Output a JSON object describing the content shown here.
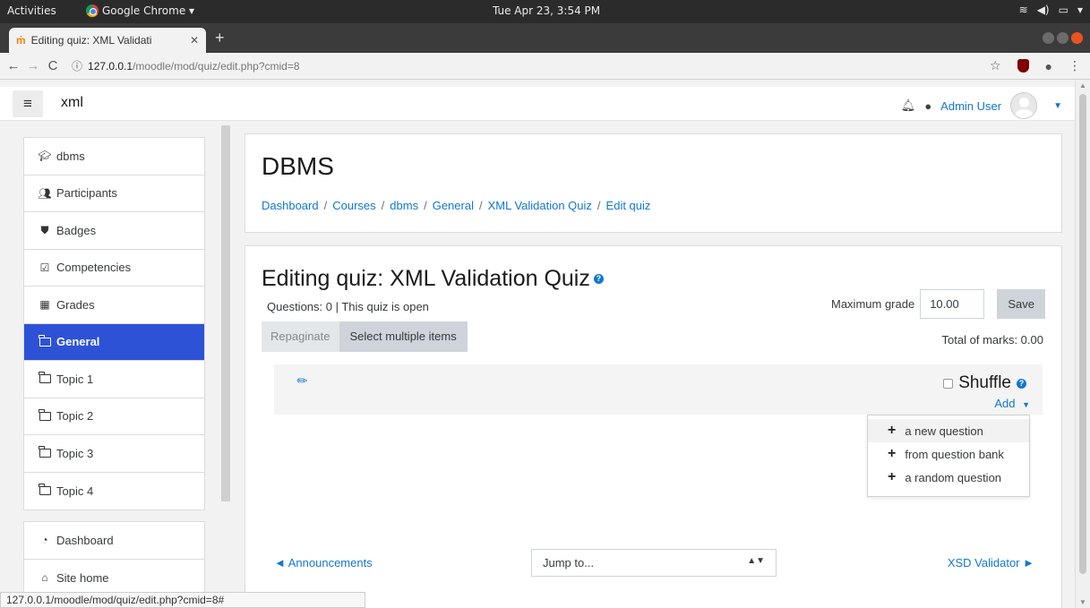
{
  "os_topbar": {
    "activities": "Activities",
    "app_menu": "Google Chrome ▾",
    "clock": "Tue Apr 23,  3:54 PM",
    "sys_icons": [
      "wifi-icon",
      "volume-icon",
      "battery-icon",
      "caret-down-icon"
    ]
  },
  "browser": {
    "tab_title": "Editing quiz: XML Validati",
    "tab_favicon": "moodle-icon",
    "url_host": "127.0.0.1",
    "url_path": "/moodle/mod/quiz/edit.php?cmid=8",
    "status_url": "127.0.0.1/moodle/mod/quiz/edit.php?cmid=8#"
  },
  "navbar": {
    "site_name": "xml",
    "user_name": "Admin User"
  },
  "drawer": {
    "course_items": [
      {
        "label": "dbms",
        "icon": "graduation-cap-icon"
      },
      {
        "label": "Participants",
        "icon": "users-icon"
      },
      {
        "label": "Badges",
        "icon": "shield-icon"
      },
      {
        "label": "Competencies",
        "icon": "check-square-icon"
      },
      {
        "label": "Grades",
        "icon": "table-icon"
      },
      {
        "label": "General",
        "icon": "folder-icon",
        "active": true
      },
      {
        "label": "Topic 1",
        "icon": "folder-icon"
      },
      {
        "label": "Topic 2",
        "icon": "folder-icon"
      },
      {
        "label": "Topic 3",
        "icon": "folder-icon"
      },
      {
        "label": "Topic 4",
        "icon": "folder-icon"
      }
    ],
    "site_items": [
      {
        "label": "Dashboard",
        "icon": "tachometer-icon"
      },
      {
        "label": "Site home",
        "icon": "home-icon"
      }
    ]
  },
  "header": {
    "course_title": "DBMS",
    "breadcrumb": [
      "Dashboard",
      "Courses",
      "dbms",
      "General",
      "XML Validation Quiz",
      "Edit quiz"
    ],
    "separator": "/"
  },
  "quiz": {
    "title": "Editing quiz: XML Validation Quiz",
    "status": "Questions: 0 | This quiz is open",
    "max_grade_label": "Maximum grade",
    "max_grade_value": "10.00",
    "save_label": "Save",
    "repaginate_label": "Repaginate",
    "select_multiple_label": "Select multiple items",
    "total_marks": "Total of marks: 0.00",
    "shuffle_label": "Shuffle",
    "add_label": "Add",
    "add_menu": [
      "a new question",
      "from question bank",
      "a random question"
    ],
    "prev_link": "◄ Announcements",
    "jump_to": "Jump to...",
    "next_link": "XSD Validator ►"
  },
  "colors": {
    "accent": "#1177d1",
    "active_nav": "#2d52d6",
    "button_grey": "#ced4da"
  }
}
